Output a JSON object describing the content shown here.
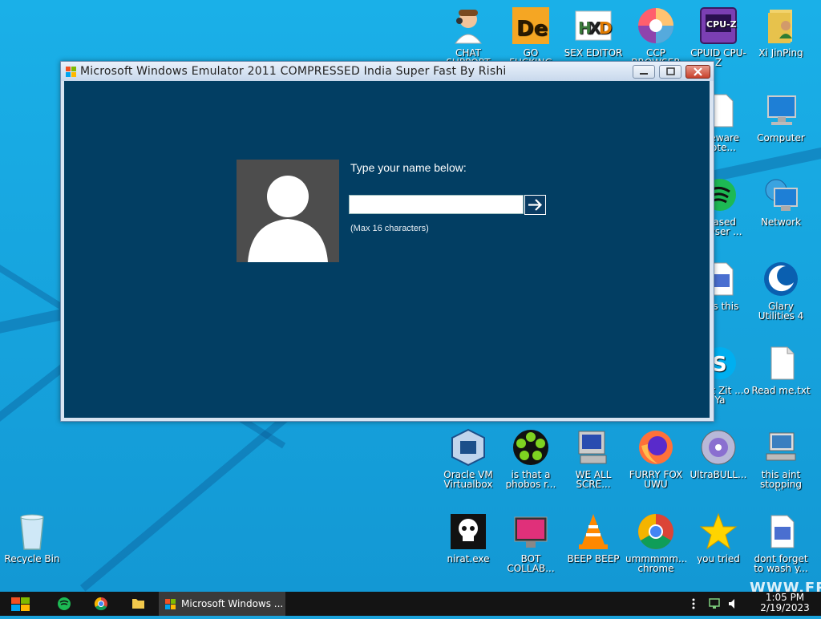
{
  "window": {
    "title": "Microsoft Windows Emulator 2011 COMPRESSED India Super Fast By Rishi",
    "prompt": "Type your name below:",
    "input_value": "",
    "hint": "(Max 16 characters)",
    "client_bg": "#023e63"
  },
  "desktop_icons": [
    {
      "label": "CHAT SUPPORT",
      "icon": "support-person-icon"
    },
    {
      "label": "GO FUCKING DIE WHORE",
      "icon": "de-app-icon"
    },
    {
      "label": "SEX EDITOR",
      "icon": "hxd-editor-icon"
    },
    {
      "label": "CCP BROWSER",
      "icon": "colorful-browser-icon"
    },
    {
      "label": "CPUID CPU-Z",
      "icon": "cpu-z-icon"
    },
    {
      "label": "Xi JinPing",
      "icon": "user-folder-icon"
    },
    {
      "label": "...eware Note...",
      "icon": "document-icon"
    },
    {
      "label": "Computer",
      "icon": "computer-icon"
    },
    {
      "label": "...ased ...wser ...",
      "icon": "spotify-icon"
    },
    {
      "label": "Network",
      "icon": "network-icon"
    },
    {
      "label": "...is this",
      "icon": "calendar-file-icon"
    },
    {
      "label": "Glary Utilities 4",
      "icon": "glary-icon"
    },
    {
      "label": "...hat Zit ...o Ya",
      "icon": "skype-icon"
    },
    {
      "label": "Read me.txt",
      "icon": "text-file-icon"
    },
    {
      "label": "Oracle VM Virtualbox",
      "icon": "virtualbox-icon"
    },
    {
      "label": "is that a phobos r...",
      "icon": "icq-flower-icon"
    },
    {
      "label": "WE ALL SCRE...",
      "icon": "computer-screen-icon"
    },
    {
      "label": "FURRY FOX UWU",
      "icon": "firefox-icon"
    },
    {
      "label": "UltraBULL...",
      "icon": "disc-icon"
    },
    {
      "label": "this aint stopping di...",
      "icon": "network-pc-icon"
    },
    {
      "label": "Recycle Bin",
      "icon": "recycle-bin-icon"
    },
    {
      "label": "nirat.exe",
      "icon": "skull-icon"
    },
    {
      "label": "BOT COLLAB...",
      "icon": "monitor-pink-icon"
    },
    {
      "label": "BEEP BEEP",
      "icon": "vlc-cone-icon"
    },
    {
      "label": "ummmmm... chrome",
      "icon": "chrome-icon"
    },
    {
      "label": "you tried",
      "icon": "star-icon"
    },
    {
      "label": "dont forget to wash y...",
      "icon": "calendar-file-icon"
    }
  ],
  "taskbar": {
    "window_label": "Microsoft Windows ...",
    "time": "1:05 PM",
    "date": "2/19/2023"
  },
  "watermark": "WWW.FR"
}
